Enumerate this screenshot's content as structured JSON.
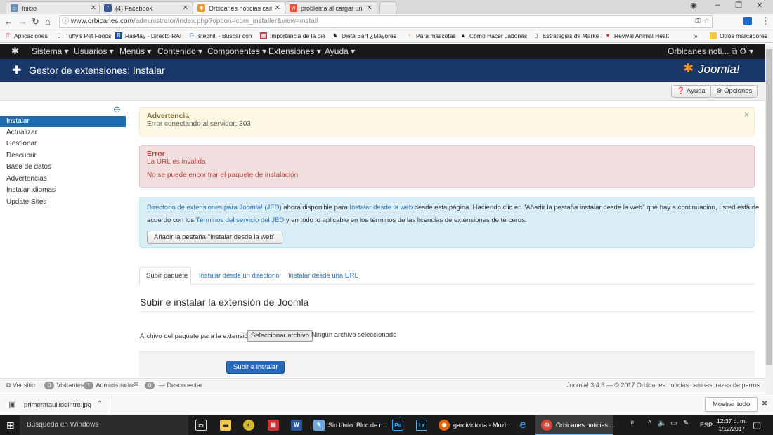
{
  "browser": {
    "tabs": [
      {
        "label": "Inicio",
        "icon": "tab-favicon-inicio"
      },
      {
        "label": "(4) Facebook",
        "icon": "facebook-icon"
      },
      {
        "label": "Orbicanes noticias canin",
        "icon": "joomla-favicon"
      },
      {
        "label": "problema al cargar un m",
        "icon": "forum-favicon"
      }
    ],
    "url_host": "www.orbicanes.com",
    "url_path": "/administrator/index.php?option=com_installer&view=install",
    "bookmarks": [
      "Aplicaciones",
      "Tuffy's Pet Foods",
      "RaiPlay - Directo RAI",
      "stephill - Buscar con",
      "Importancia de la die",
      "Dieta Barf ¿Mayores",
      "Para mascotas",
      "Cómo Hacer Jabones",
      "Estrategias de Marke",
      "Revival Animal Healt",
      "»",
      "Otros marcadores"
    ]
  },
  "joomla": {
    "menu": [
      "Sistema ▾",
      "Usuarios ▾",
      "Menús ▾",
      "Contenido ▾",
      "Componentes ▾",
      "Extensiones ▾",
      "Ayuda ▾"
    ],
    "site_name": "Orbicanes noti...",
    "page_title": "Gestor de extensiones: Instalar",
    "logo_text": "Joomla!",
    "toolbar": {
      "help": "Ayuda",
      "options": "Opciones"
    },
    "sidebar": [
      "Instalar",
      "Actualizar",
      "Gestionar",
      "Descubrir",
      "Base de datos",
      "Advertencias",
      "Instalar idiomas",
      "Update Sites"
    ],
    "warning": {
      "title": "Advertencia",
      "text": "Error conectando al servidor: 303"
    },
    "error": {
      "title": "Error",
      "line1": "La URL es inválida",
      "line2": "No se puede encontrar el paquete de instalación"
    },
    "info": {
      "link1": "Directorio de extensiones para Joomla! (JED)",
      "t1": " ahora disponible para ",
      "link2": "Instalar desde la web",
      "t2": " desde esta página.  Haciendo clic en \"Añadir la pestaña instalar desde la web\" que hay a continuación, usted está de",
      "t3": "acuerdo con los ",
      "link3": "Términos del servicio del JED",
      "t4": " y en todo lo aplicable en los términos de las licencias de extensiones de terceros.",
      "button": "Añadir la pestaña \"Instalar desde la web\""
    },
    "tabs": [
      "Subir paquete",
      "Instalar desde un directorio",
      "Instalar desde una URL"
    ],
    "section_title": "Subir e instalar la extensión de Joomla",
    "file_label": "Archivo del paquete para la extensión",
    "file_button": "Seleccionar archivo",
    "file_status": "Ningún archivo seleccionado",
    "submit": "Subir e instalar",
    "status": {
      "view_site": "Ver sitio",
      "visitors_count": "0",
      "visitors": "Visitantes",
      "admins_count": "1",
      "admins": "Administrador",
      "messages_count": "0",
      "logout": "Desconectar",
      "footer": "Joomla! 3.4.8 — © 2017 Orbicanes noticias caninas, razas de perros"
    }
  },
  "downloads": {
    "file": "primermaullidointro.jpg",
    "show_all": "Mostrar todo"
  },
  "taskbar": {
    "search": "Búsqueda en Windows",
    "apps": [
      "Sin título: Bloc de n...",
      "garcivictoria - Mozi...",
      "Orbicanes noticias ..."
    ],
    "lang": "ESP",
    "time": "12:37 p. m.",
    "date": "1/12/2017"
  },
  "colors": {
    "joomla_header": "#1a3867",
    "sidebar_active": "#1d6cb0",
    "warning_bg": "#fcf8e3",
    "error_bg": "#f2dede",
    "info_bg": "#d9edf7",
    "submit": "#2a69b8"
  }
}
